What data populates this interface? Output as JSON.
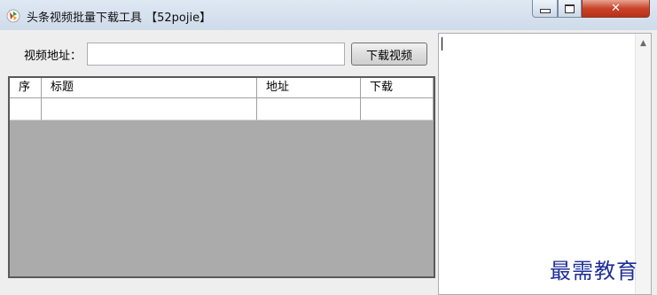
{
  "window": {
    "title": "头条视频批量下载工具 【52pojie】",
    "controls": {
      "minimize_icon": "minimize-icon",
      "maximize_icon": "maximize-icon",
      "close_icon": "close-icon",
      "close_glyph": "✕"
    }
  },
  "form": {
    "url_label": "视频地址：",
    "url_value": "",
    "url_placeholder": "",
    "download_button": "下载视频"
  },
  "table": {
    "columns": [
      "序",
      "标题",
      "地址",
      "下载"
    ],
    "rows": [
      [
        "",
        "",
        "",
        ""
      ]
    ]
  },
  "log": {
    "text": ""
  },
  "watermark": "最需教育",
  "colors": {
    "grid_background": "#ababab",
    "title_bar": "#d6e0ec",
    "close_button": "#c8432a",
    "watermark": "#1e2f9a"
  }
}
